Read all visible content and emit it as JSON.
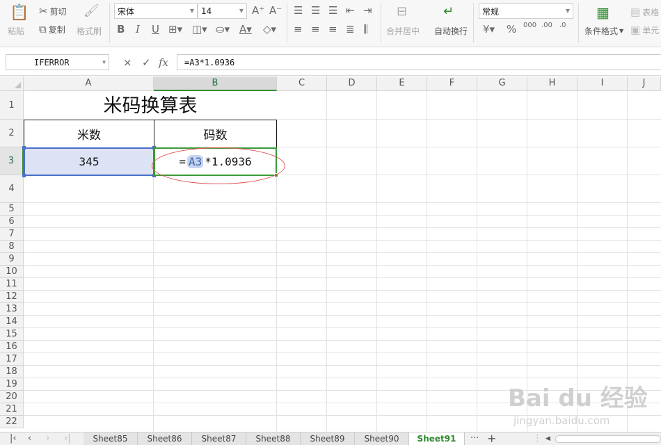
{
  "ribbon": {
    "paste": "粘贴",
    "cut": "剪切",
    "copy": "复制",
    "format_painter": "格式刷",
    "font_name": "宋体",
    "font_size": "14",
    "merge_center": "合并居中",
    "wrap_text": "自动换行",
    "number_format": "常规",
    "conditional_format": "条件格式",
    "table_style": "表格",
    "cell": "单元"
  },
  "formula_bar": {
    "name_box": "IFERROR",
    "cancel": "×",
    "confirm": "✓",
    "fx": "fx",
    "formula": "=A3*1.0936"
  },
  "columns": [
    "A",
    "B",
    "C",
    "D",
    "E",
    "F",
    "G",
    "H",
    "I",
    "J"
  ],
  "rows": [
    "1",
    "2",
    "3",
    "4",
    "5",
    "6",
    "7",
    "8",
    "9",
    "10",
    "11",
    "12",
    "13",
    "14",
    "15",
    "16",
    "17",
    "18",
    "19",
    "20",
    "21",
    "22"
  ],
  "cells": {
    "title": "米码换算表",
    "a2": "米数",
    "b2": "码数",
    "a3": "345",
    "b3_eq": "=",
    "b3_ref": "A3",
    "b3_rest": "*1.0936"
  },
  "sheet_tabs": [
    "Sheet85",
    "Sheet86",
    "Sheet87",
    "Sheet88",
    "Sheet89",
    "Sheet90",
    "Sheet91"
  ],
  "active_sheet": "Sheet91",
  "tab_more": "···",
  "tab_add": "+",
  "watermark": {
    "brand": "Bai du 经验",
    "url": "jingyan.baidu.com"
  }
}
